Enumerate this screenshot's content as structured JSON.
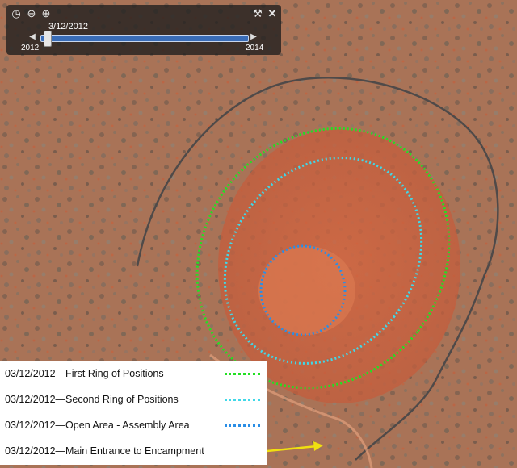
{
  "timebar": {
    "date_label": "3/12/2012",
    "start_year": "2012",
    "end_year": "2014",
    "icons": [
      "clock-icon",
      "zoom-out-icon",
      "zoom-in-icon",
      "wrench-icon",
      "close-icon",
      "step-back-icon",
      "step-forward-icon"
    ]
  },
  "legend": {
    "items": [
      {
        "label": "03/12/2012—First Ring of Positions",
        "color": "#22e022",
        "style": "dotted"
      },
      {
        "label": "03/12/2012—Second Ring of Positions",
        "color": "#40d8e8",
        "style": "dotted"
      },
      {
        "label": "03/12/2012—Open Area - Assembly Area",
        "color": "#2a8ee6",
        "style": "dotted"
      },
      {
        "label": "03/12/2012—Main Entrance to Encampment",
        "color": "#f0e010",
        "style": "arrow"
      }
    ]
  }
}
